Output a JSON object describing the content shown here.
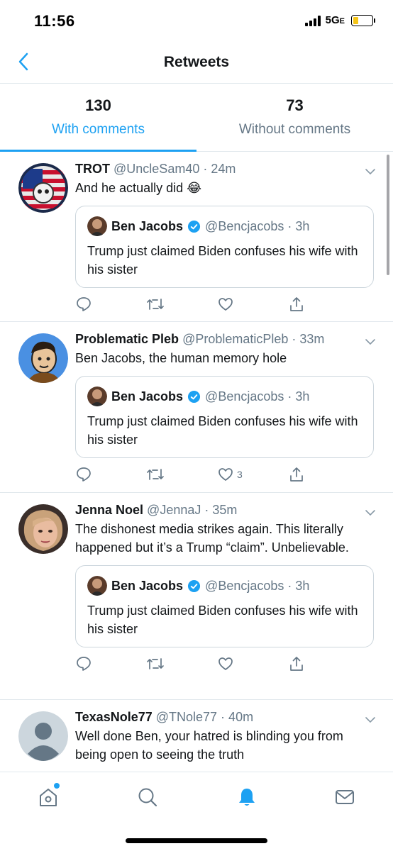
{
  "status_bar": {
    "time": "11:56",
    "network": "5G",
    "network_suffix": "E"
  },
  "header": {
    "title": "Retweets"
  },
  "tabs": [
    {
      "count": "130",
      "label": "With comments",
      "active": true
    },
    {
      "count": "73",
      "label": "Without comments",
      "active": false
    }
  ],
  "tweets": [
    {
      "name": "TROT",
      "meta": "@UncleSam40 · 24m",
      "text": "And he actually did 😂",
      "quote": {
        "name": "Ben Jacobs",
        "meta": "@Bencjacobs · 3h",
        "text": "Trump just claimed Biden confuses his wife with his sister"
      },
      "like_count": ""
    },
    {
      "name": "Problematic Pleb",
      "meta": "@ProblematicPleb · 33m",
      "text": "Ben Jacobs, the human memory hole",
      "quote": {
        "name": "Ben Jacobs",
        "meta": "@Bencjacobs · 3h",
        "text": "Trump just claimed Biden confuses his wife with his sister"
      },
      "like_count": "3"
    },
    {
      "name": "Jenna Noel",
      "meta": "@JennaJ · 35m",
      "text": "The dishonest media strikes again. This literally happened but it’s a Trump “claim”. Unbelievable.",
      "quote": {
        "name": "Ben Jacobs",
        "meta": "@Bencjacobs · 3h",
        "text": "Trump just claimed Biden confuses his wife with his sister"
      },
      "like_count": ""
    },
    {
      "name": "TexasNole77",
      "meta": "@TNole77 · 40m",
      "text": "Well done Ben, your hatred is blinding you from being open to seeing the truth"
    }
  ],
  "colors": {
    "accent": "#1da1f2",
    "text": "#14171a",
    "muted": "#657786",
    "border": "#e1e8ed"
  },
  "icons": [
    "back-arrow-icon",
    "chevron-down-icon",
    "reply-icon",
    "retweet-icon",
    "like-icon",
    "share-icon",
    "verified-icon",
    "home-icon",
    "search-icon",
    "notifications-icon",
    "messages-icon"
  ]
}
